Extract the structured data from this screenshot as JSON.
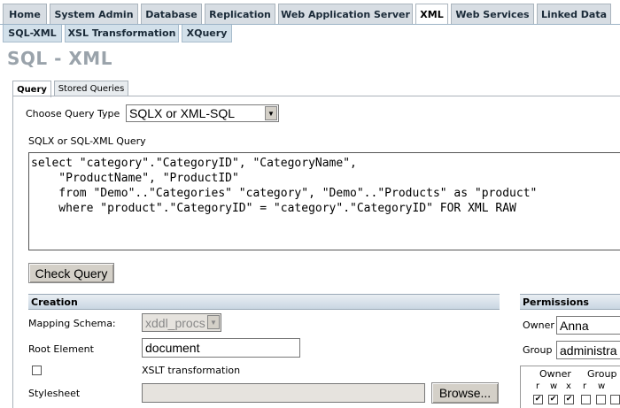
{
  "top_tabs": [
    "Home",
    "System Admin",
    "Database",
    "Replication",
    "Web Application Server",
    "XML",
    "Web Services",
    "Linked Data"
  ],
  "active_top_tab": "XML",
  "sub_tabs": [
    "SQL-XML",
    "XSL Transformation",
    "XQuery"
  ],
  "page_title": "SQL - XML",
  "query_tabs": [
    "Query",
    "Stored Queries"
  ],
  "query_type": {
    "label": "Choose Query Type",
    "value": "SQLX or XML-SQL"
  },
  "query_label": "SQLX or SQL-XML Query",
  "query_lines": [
    "select \"category\".\"CategoryID\", \"CategoryName\",",
    "    \"ProductName\", \"ProductID\"",
    "    from \"Demo\"..\"Categories\" \"category\", \"Demo\"..\"Products\" as \"product\"",
    "    where \"product\".\"CategoryID\" = \"category\".\"CategoryID\" FOR XML RAW"
  ],
  "check_button": "Check Query",
  "creation": {
    "header": "Creation",
    "mapping_label": "Mapping Schema:",
    "mapping_value": "xddl_procs",
    "root_label": "Root Element",
    "root_value": "document",
    "xslt_label": "XSLT transformation",
    "stylesheet_label": "Stylesheet",
    "browse_button": "Browse..."
  },
  "permissions": {
    "header": "Permissions",
    "owner_label": "Owner",
    "owner_value": "Anna",
    "group_label": "Group",
    "group_value": "administra",
    "owner_col": "Owner",
    "group_col": "Group",
    "bits_owner": [
      "r",
      "w",
      "x"
    ],
    "bits_group": [
      "r",
      "w"
    ]
  },
  "colors": {
    "tab_bg": "#d7dde3",
    "subtab_bg": "#d2e0ea",
    "title": "#9aa3ab",
    "section_header": "#c9d6e2"
  }
}
